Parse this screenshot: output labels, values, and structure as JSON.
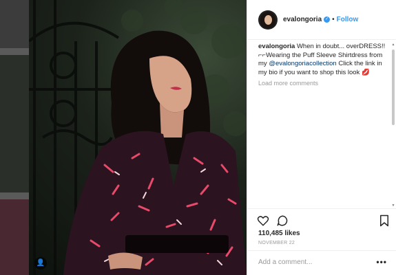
{
  "post": {
    "username": "evalongoria",
    "follow_label": "Follow",
    "separator": "•",
    "verified_glyph": "✓",
    "caption_user": "evalongoria",
    "caption_part1": " When in doubt... overDRESS!! ",
    "caption_part2": "Wearing the Puff Sleeve Shirtdress from my ",
    "caption_mention": "@evalongoriacollection",
    "caption_part3": " Click the link in my bio if you want to shop this look 💋",
    "caption_glyphs": "⌐⌐",
    "load_more": "Load more comments",
    "likes": "110,485 likes",
    "date": "NOVEMBER 22",
    "add_comment_placeholder": "Add a comment...",
    "more_options": "•••",
    "user_tag_glyph": "👤"
  },
  "icons": [
    "heart-icon",
    "comment-icon",
    "bookmark-icon",
    "user-tag-icon",
    "verified-icon"
  ],
  "colors": {
    "accent": "#3897f0",
    "text": "#262626",
    "muted": "#999999",
    "dress_base": "#2b1320",
    "dress_pattern": "#e84a6a"
  }
}
